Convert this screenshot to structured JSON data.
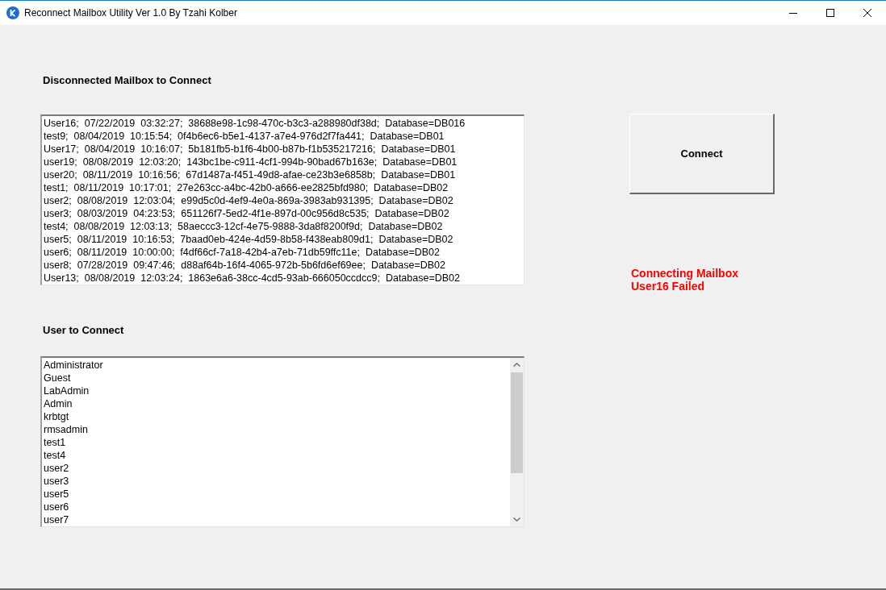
{
  "window": {
    "title": "Reconnect Mailbox Utility Ver 1.0 By Tzahi Kolber"
  },
  "disconnected_mailboxes": {
    "label": "Disconnected Mailbox to Connect",
    "items": [
      {
        "text": "User16;  07/22/2019  03:32:27;  38688e98-1c98-470c-b3c3-a288980df38d;  Database=DB016",
        "selected": false
      },
      {
        "text": "test9;  08/04/2019  10:15:54;  0f4b6ec6-b5e1-4137-a7e4-976d2f7fa441;  Database=DB01",
        "selected": false
      },
      {
        "text": "User17;  08/04/2019  10:16:07;  5b181fb5-b1f6-4b00-b87b-f1b535217216;  Database=DB01",
        "selected": false
      },
      {
        "text": "user19;  08/08/2019  12:03:20;  143bc1be-c911-4cf1-994b-90bad67b163e;  Database=DB01",
        "selected": false
      },
      {
        "text": "user20;  08/11/2019  10:16:56;  67d1487a-f451-49d8-afae-ce23b3e6858b;  Database=DB01",
        "selected": false
      },
      {
        "text": "test1;  08/11/2019  10:17:01;  27e263cc-a4bc-42b0-a666-ee2825bfd980;  Database=DB02",
        "selected": false
      },
      {
        "text": "user2;  08/08/2019  12:03:04;  e99d5c0d-4ef9-4e0a-869a-3983ab931395;  Database=DB02",
        "selected": false
      },
      {
        "text": "user3;  08/03/2019  04:23:53;  651126f7-5ed2-4f1e-897d-00c956d8c535;  Database=DB02",
        "selected": false
      },
      {
        "text": "test4;  08/08/2019  12:03:13;  58aeccc3-12cf-4e75-9888-3da8f8200f9d;  Database=DB02",
        "selected": false
      },
      {
        "text": "user5;  08/11/2019  10:16:53;  7baad0eb-424e-4d59-8b58-f438eab809d1;  Database=DB02",
        "selected": false
      },
      {
        "text": "user6;  08/11/2019  10:00:00;  f4df66cf-7a18-42b4-a7eb-71db59ffc11e;  Database=DB02",
        "selected": false
      },
      {
        "text": "user8;  07/28/2019  09:47:46;  d88af64b-16f4-4065-972b-5b6fd6ef69ee;  Database=DB02",
        "selected": false
      },
      {
        "text": "User13;  08/08/2019  12:03:24;  1863e6a6-38cc-4cd5-93ab-666050ccdcc9;  Database=DB02",
        "selected": false
      }
    ]
  },
  "users": {
    "label": "User to Connect",
    "items": [
      {
        "text": "Administrator",
        "selected": false
      },
      {
        "text": "Guest",
        "selected": false
      },
      {
        "text": "LabAdmin",
        "selected": false
      },
      {
        "text": "Admin",
        "selected": false
      },
      {
        "text": "krbtgt",
        "selected": false
      },
      {
        "text": "rmsadmin",
        "selected": false
      },
      {
        "text": "test1",
        "selected": false
      },
      {
        "text": "test4",
        "selected": false
      },
      {
        "text": "user2",
        "selected": false
      },
      {
        "text": "user3",
        "selected": false
      },
      {
        "text": "user5",
        "selected": false
      },
      {
        "text": "user6",
        "selected": false
      },
      {
        "text": "user7",
        "selected": false
      }
    ]
  },
  "connect_button": {
    "label": "Connect"
  },
  "status_message": {
    "text": "Connecting Mailbox User16 Failed"
  }
}
